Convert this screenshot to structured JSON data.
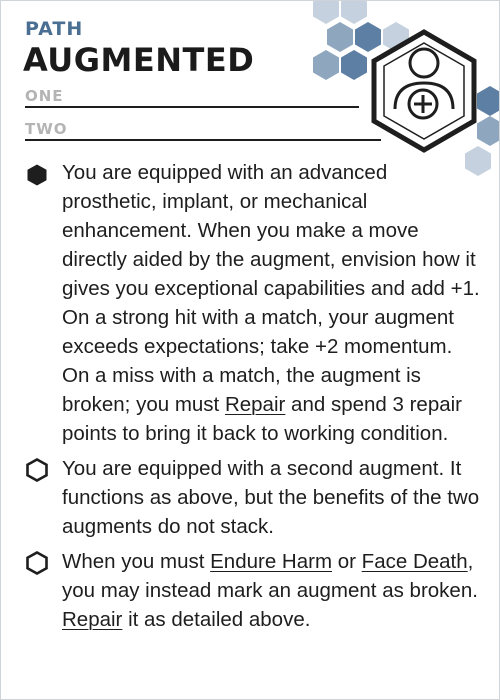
{
  "card": {
    "category": "PATH",
    "title": "AUGMENTED",
    "slots": [
      "ONE",
      "TWO"
    ],
    "icon": "user-with-plus-icon",
    "colors": {
      "accent": "#4a6f92",
      "hex_light": "#c5d1de",
      "hex_mid": "#8fa6bf",
      "hex_dark": "#5d7fa3",
      "text": "#1e1e1e"
    }
  },
  "abilities": [
    {
      "checked": true,
      "segments": [
        {
          "text": "You are equipped with an advanced prosthetic, implant, or mechanical enhancement. When you make a move directly aided by the augment, envision how it gives you exceptional capabilities and add +1. On a strong hit with a match, your augment exceeds expectations; take +2 momentum. On a miss with a match, the augment is broken; you must "
        },
        {
          "text": "Repair",
          "link": true
        },
        {
          "text": " and spend 3 repair points to bring it back to working condition."
        }
      ]
    },
    {
      "checked": false,
      "segments": [
        {
          "text": "You are equipped with a second augment. It functions as above, but the benefits of the two augments do not stack."
        }
      ]
    },
    {
      "checked": false,
      "segments": [
        {
          "text": "When you must "
        },
        {
          "text": "Endure Harm",
          "link": true
        },
        {
          "text": " or "
        },
        {
          "text": "Face Death",
          "link": true
        },
        {
          "text": ", you may instead mark an augment as broken. "
        },
        {
          "text": "Repair",
          "link": true
        },
        {
          "text": " it as detailed above."
        }
      ]
    }
  ]
}
